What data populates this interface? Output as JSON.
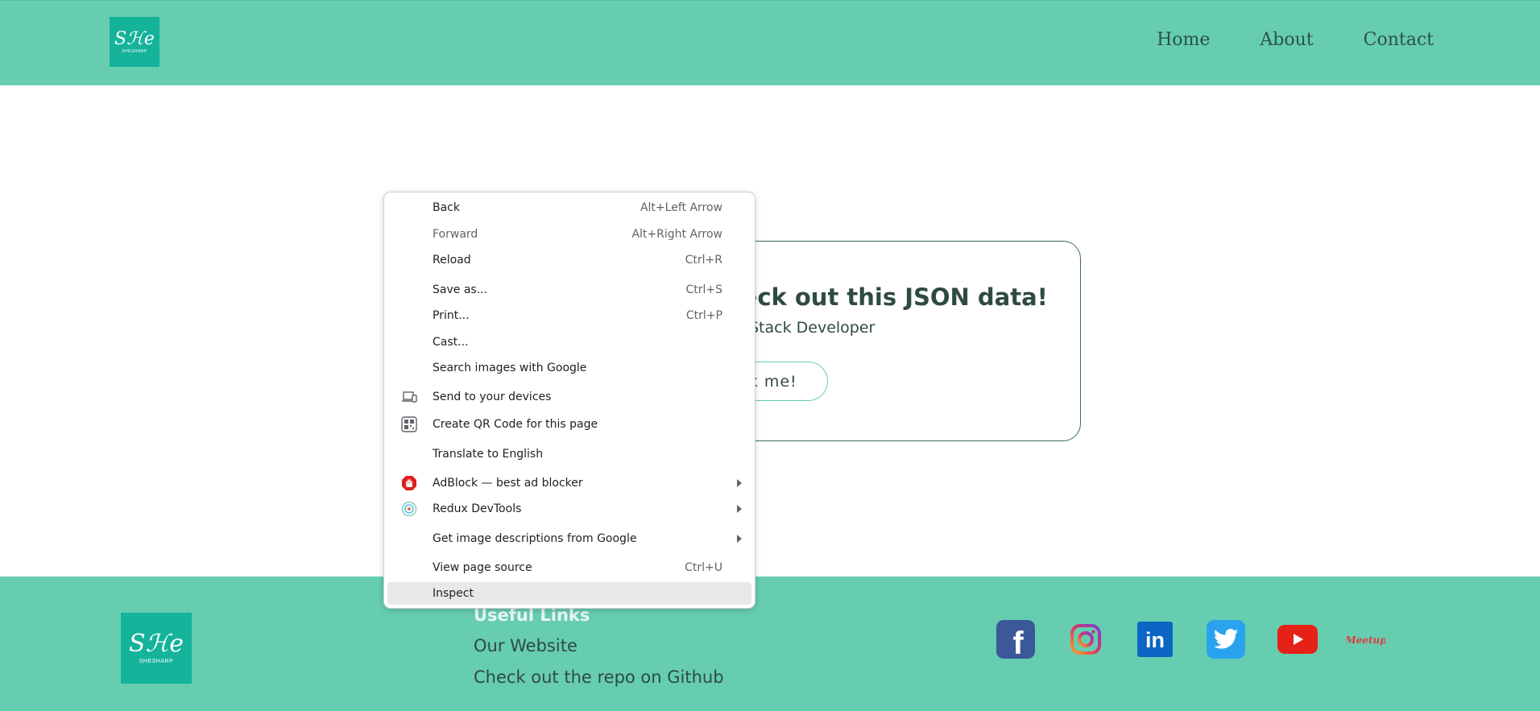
{
  "header": {
    "logo": {
      "mark": "Sℋe",
      "word": "SHESHARP"
    },
    "nav": [
      {
        "label": "Home"
      },
      {
        "label": "About"
      },
      {
        "label": "Contact"
      }
    ],
    "background_color": "#66cdb0"
  },
  "card": {
    "title": "heck out this JSON data!",
    "subtitle": "Stack Developer",
    "button_label": "ck me!"
  },
  "context_menu": {
    "items": [
      {
        "label": "Back",
        "shortcut": "Alt+Left Arrow"
      },
      {
        "label": "Forward",
        "shortcut": "Alt+Right Arrow"
      },
      {
        "label": "Reload",
        "shortcut": "Ctrl+R"
      },
      {
        "label": "Save as...",
        "shortcut": "Ctrl+S"
      },
      {
        "label": "Print...",
        "shortcut": "Ctrl+P"
      },
      {
        "label": "Cast..."
      },
      {
        "label": "Search images with Google"
      },
      {
        "label": "Send to your devices",
        "icon": "devices-icon"
      },
      {
        "label": "Create QR Code for this page",
        "icon": "qr-code-icon"
      },
      {
        "label": "Translate to English"
      },
      {
        "label": "AdBlock — best ad blocker",
        "icon": "adblock-icon"
      },
      {
        "label": "Redux DevTools",
        "icon": "redux-devtools-icon"
      },
      {
        "label": "Get image descriptions from Google"
      },
      {
        "label": "View page source",
        "shortcut": "Ctrl+U"
      },
      {
        "label": "Inspect"
      }
    ]
  },
  "footer": {
    "logo": {
      "mark": "Sℋe",
      "word": "SHESHARP"
    },
    "links_title": "Useful Links",
    "links": [
      {
        "label": "Our Website"
      },
      {
        "label": "Check out the repo on Github"
      }
    ],
    "social": [
      {
        "icon": "facebook-icon",
        "glyph": "f",
        "color": "#3b5998"
      },
      {
        "icon": "instagram-icon",
        "color": "#c13584"
      },
      {
        "icon": "linkedin-icon",
        "glyph": "in",
        "color": "#0a66c2"
      },
      {
        "icon": "twitter-icon",
        "color": "#1da1f2"
      },
      {
        "icon": "youtube-icon",
        "color": "#e62117"
      },
      {
        "icon": "meetup-icon",
        "glyph": "Meetup",
        "color": "#e0393e"
      }
    ]
  }
}
